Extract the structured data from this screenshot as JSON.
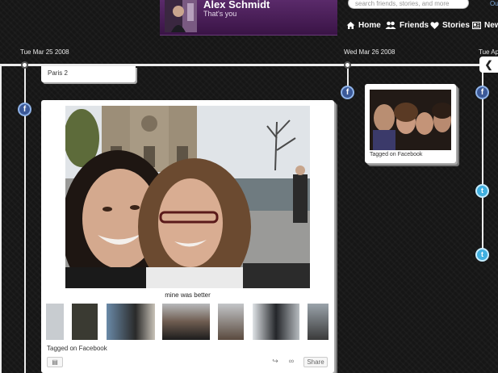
{
  "profile": {
    "name": "Alex Schmidt",
    "subtitle": "That's you"
  },
  "search": {
    "placeholder": "search friends, stories, and more",
    "extra_link": "Ou"
  },
  "nav": {
    "home": "Home",
    "friends": "Friends",
    "stories": "Stories",
    "news": "New"
  },
  "timeline": {
    "dates": [
      "Tue Mar 25 2008",
      "Wed Mar 26 2008",
      "Tue Ap"
    ]
  },
  "stub_card": {
    "text": "Paris 2"
  },
  "main_card": {
    "caption": "mine was better",
    "tagged": "Tagged on Facebook",
    "share_label": "Share",
    "thumb_count": 8
  },
  "small_card": {
    "tagged": "Tagged on Facebook"
  },
  "badges": {
    "facebook": "f",
    "twitter": "t"
  },
  "colors": {
    "background": "#161616",
    "profile_bg": "#4a1f5a",
    "facebook_blue": "#3b5998",
    "twitter_blue": "#41b0e0"
  },
  "icons": [
    "home-icon",
    "friends-icon",
    "heart-icon",
    "news-icon",
    "chevron-left-icon",
    "comments-icon",
    "share-icon",
    "link-icon"
  ]
}
